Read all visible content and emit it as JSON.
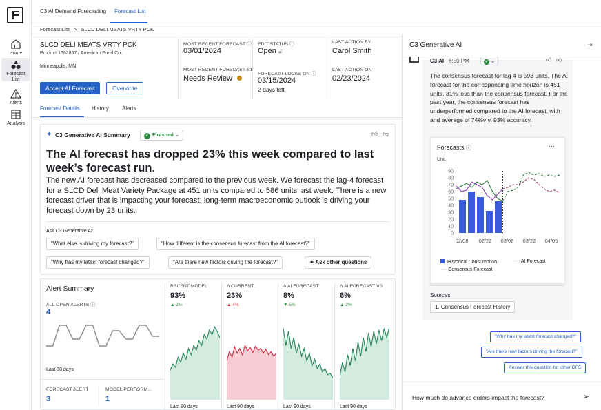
{
  "rail": {
    "items": [
      {
        "label": "Home"
      },
      {
        "label": "Forecast\nList"
      },
      {
        "label": "Alerts"
      },
      {
        "label": "Analysis"
      }
    ]
  },
  "topbar": {
    "tabs": [
      "C3 AI Demand Forecasting",
      "Forecast List"
    ]
  },
  "breadcrumb": {
    "root": "Forecast List",
    "sep": ">",
    "current": "SLCD DELI MEATS VRTY PCK"
  },
  "product": {
    "name": "SLCD DELI MEATS VRTY PCK",
    "sub": "Product 1592837 / American Food Co.",
    "location": "Minneapolis, MN",
    "accept_label": "Accept AI Forecast",
    "overwrite_label": "Overwrite"
  },
  "fields": {
    "most_recent_forecast": {
      "label": "MOST RECENT FORECAST",
      "value": "03/01/2024"
    },
    "most_recent_forecast_s": {
      "label": "MOST RECENT FORECAST S1",
      "value": "Needs Review"
    },
    "edit_status": {
      "label": "EDIT STATUS",
      "value": "Open"
    },
    "forecast_locks_on": {
      "label": "FORECAST LOCKS ON",
      "value": "03/15/2024",
      "sub": "2 days left"
    },
    "last_action_by": {
      "label": "LAST ACTION BY",
      "value": "Carol Smith"
    },
    "last_action_on": {
      "label": "LAST ACTION ON",
      "value": "02/23/2024"
    }
  },
  "subtabs": [
    "Forecast Details",
    "History",
    "Alerts"
  ],
  "summary": {
    "title": "C3 Generative AI Summary",
    "status": "Finished",
    "headline": "The AI forecast has dropped 23% this week compared to last week’s forecast run.",
    "body": "The new AI forecast has decreased compared to the previous week. We forecast the lag-4 forecast for a SLCD Deli Meat Variety Package at 451 units compared to 586 units last week. There is a new forecast driver that is impacting your forecast: long-term macroeconomic outlook is driving your forecast down by 23 units.",
    "ask_label": "Ask C3 Generative AI:",
    "questions": [
      "\"What else is driving my forecast?\"",
      "\"How different is the consensus forecast from the AI forecast?\"",
      "\"Why has my latest forecast changed?\"",
      "\"Are there new factors driving the forecast?\""
    ],
    "other_label": "Ask other questions"
  },
  "alert_summary": {
    "title": "Alert Summary",
    "all_open_label": "ALL OPEN ALERTS",
    "all_open_value": "4",
    "period": "Last 30 days",
    "forecast_alerts_label": "FORECAST ALERT",
    "forecast_alerts_value": "3",
    "model_perf_label": "MODEL PERFORM...",
    "model_perf_value": "1"
  },
  "metrics": [
    {
      "label": "RECENT MODEL",
      "value": "93%",
      "delta": "▲ 2%",
      "delta_color": "#2a8a3e",
      "color": "#2a8a5e",
      "fill": "#cfe9dc",
      "period": "Last 90 days",
      "trend": [
        38,
        46,
        42,
        55,
        48,
        60,
        52,
        66,
        58,
        70,
        64,
        76,
        70,
        84,
        78,
        90,
        84,
        94,
        88,
        80
      ]
    },
    {
      "label": "Δ CURRENT...",
      "value": "23%",
      "delta": "▲ 4%",
      "delta_color": "#d33",
      "color": "#d4344c",
      "fill": "#f7c9d2",
      "period": "Last 90 days",
      "trend": [
        50,
        62,
        55,
        68,
        60,
        66,
        58,
        70,
        63,
        67,
        61,
        69,
        64,
        66,
        60,
        65,
        58,
        62,
        56,
        60
      ]
    },
    {
      "label": "Δ AI FORECAST",
      "value": "8%",
      "delta": "▼ 5%",
      "delta_color": "#2a8a3e",
      "color": "#2a8a5e",
      "fill": "#cfe9dc",
      "period": "Last 90 days",
      "trend": [
        92,
        70,
        88,
        66,
        80,
        60,
        72,
        56,
        66,
        50,
        60,
        44,
        52,
        40,
        46,
        36,
        40,
        32,
        34,
        28
      ]
    },
    {
      "label": "Δ AI FORECAST VS",
      "value": "6%",
      "delta": "▲ 2%",
      "delta_color": "#2a8a3e",
      "color": "#2a8a5e",
      "fill": "#cfe9dc",
      "period": "Last 90 days",
      "trend": [
        30,
        48,
        36,
        58,
        44,
        66,
        50,
        74,
        56,
        80,
        62,
        86,
        68,
        88,
        72,
        90,
        76,
        92,
        80,
        94
      ]
    }
  ],
  "alert_step": [
    20,
    20,
    50,
    50,
    30,
    30,
    50,
    50,
    20,
    20,
    42,
    42,
    30,
    30,
    50,
    50,
    34,
    34
  ],
  "panel": {
    "title": "C3 Generative AI",
    "sender": "C3 AI",
    "time": "6:50 PM",
    "message": "The consensus forecast for lag 4 is 593 units. The AI forecast for the corresponding time horizon is 451 units, 31% less than the consensus forecast. For the past year, the consensus forecast has underperformed compared to the AI forecast, with and average of 74%v v. 93% accuracy.",
    "chart_title": "Forecasts",
    "sources_label": "Sources:",
    "source": "1. Consensus Forecast History",
    "suggestions": [
      "\"Why has my latest forecast changed?\"",
      "\"Are there new factors driving the forecast?\"",
      "Answer this question for other DFS"
    ],
    "input_value": "How much do advance orders impact the forecast?"
  },
  "chart_data": {
    "type": "bar",
    "title": "Forecasts",
    "ylabel": "Unit",
    "ylim": [
      0,
      90
    ],
    "yticks": [
      0,
      10,
      20,
      30,
      40,
      50,
      60,
      70,
      80,
      90
    ],
    "xticks": [
      "02/08",
      "02/22",
      "03/08",
      "03/22",
      "04/05"
    ],
    "legend": [
      "Historical Consumption",
      "AI Forecast",
      "Consensus Forecast"
    ],
    "bars": {
      "name": "Historical Consumption",
      "x": [
        0,
        1,
        2,
        3,
        4
      ],
      "values": [
        48,
        60,
        52,
        32,
        46
      ]
    },
    "ai_forecast": {
      "name": "AI Forecast",
      "values": [
        64,
        68,
        72,
        66,
        74,
        70,
        76,
        60,
        50,
        46,
        60,
        62,
        66,
        84,
        88,
        84,
        86,
        82,
        84,
        82,
        84
      ]
    },
    "consensus": {
      "name": "Consensus Forecast",
      "values": [
        68,
        60,
        62,
        74,
        70,
        66,
        54,
        48,
        56,
        64,
        66,
        70,
        70,
        74,
        80,
        78,
        70,
        64,
        60,
        62,
        58
      ]
    }
  }
}
